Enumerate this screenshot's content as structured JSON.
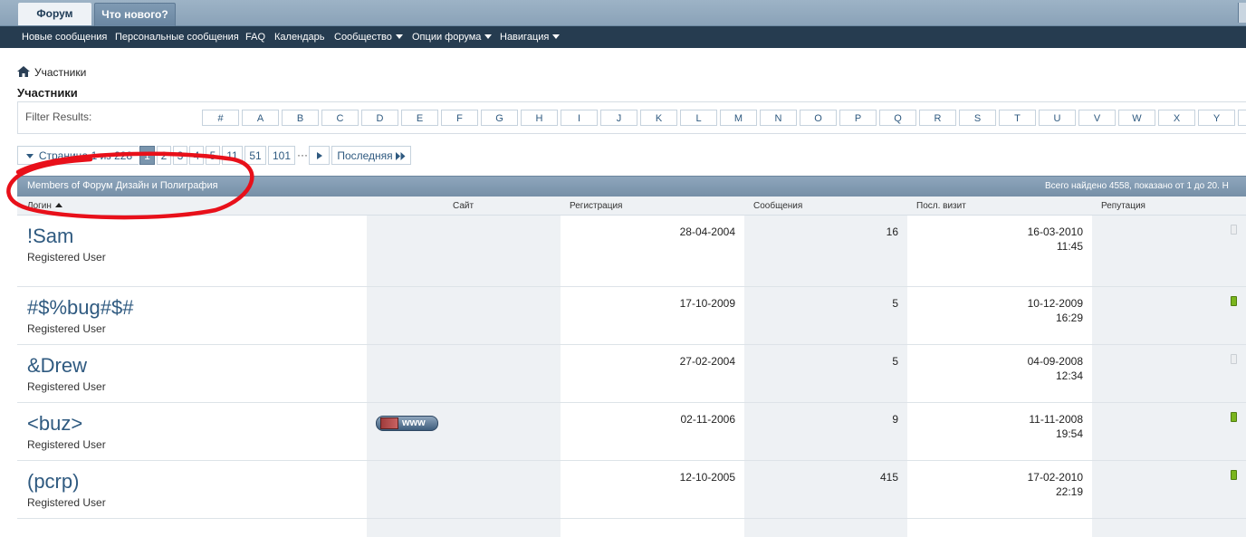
{
  "tabs": [
    {
      "label": "Форум",
      "active": true
    },
    {
      "label": "Что нового?",
      "active": false
    }
  ],
  "navbar": {
    "items": [
      {
        "label": "Новые сообщения",
        "dropdown": false
      },
      {
        "label": "Персональные сообщения",
        "dropdown": false
      },
      {
        "label": "FAQ",
        "dropdown": false
      },
      {
        "label": "Календарь",
        "dropdown": false
      },
      {
        "label": "Сообщество",
        "dropdown": true
      },
      {
        "label": "Опции форума",
        "dropdown": true
      },
      {
        "label": "Навигация",
        "dropdown": true
      }
    ]
  },
  "breadcrumb": {
    "icon": "home-icon",
    "label": "Участники"
  },
  "page_title": "Участники",
  "filter": {
    "label": "Filter Results:",
    "letters": [
      "#",
      "A",
      "B",
      "C",
      "D",
      "E",
      "F",
      "G",
      "H",
      "I",
      "J",
      "K",
      "L",
      "M",
      "N",
      "O",
      "P",
      "Q",
      "R",
      "S",
      "T",
      "U",
      "V",
      "W",
      "X",
      "Y"
    ]
  },
  "pagination": {
    "summary": "Страница 1 из 228",
    "pages": [
      "1",
      "2",
      "3",
      "4",
      "5",
      "11",
      "51",
      "101"
    ],
    "current": "1",
    "ellipsis": "···",
    "last_label": "Последняя"
  },
  "table": {
    "title": "Members of Форум Дизайн и Полиграфия",
    "info": "Всего найдено 4558, показано от 1 до 20. Н",
    "columns": {
      "login": "Логин",
      "site": "Сайт",
      "registration": "Регистрация",
      "posts": "Сообщения",
      "last_visit": "Посл. визит",
      "reputation": "Репутация"
    },
    "rows": [
      {
        "name": "!Sam",
        "title": "Registered User",
        "site": "",
        "registered": "28-04-2004",
        "posts": "16",
        "visit_date": "16-03-2010",
        "visit_time": "11:45",
        "reputation": "neutral"
      },
      {
        "name": "#$%bug#$#",
        "title": "Registered User",
        "site": "",
        "registered": "17-10-2009",
        "posts": "5",
        "visit_date": "10-12-2009",
        "visit_time": "16:29",
        "reputation": "positive"
      },
      {
        "name": "&Drew",
        "title": "Registered User",
        "site": "",
        "registered": "27-02-2004",
        "posts": "5",
        "visit_date": "04-09-2008",
        "visit_time": "12:34",
        "reputation": "neutral"
      },
      {
        "name": "<buz>",
        "title": "Registered User",
        "site": "www",
        "registered": "02-11-2006",
        "posts": "9",
        "visit_date": "11-11-2008",
        "visit_time": "19:54",
        "reputation": "positive"
      },
      {
        "name": "(pcrp)",
        "title": "Registered User",
        "site": "",
        "registered": "12-10-2005",
        "posts": "415",
        "visit_date": "17-02-2010",
        "visit_time": "22:19",
        "reputation": "positive"
      }
    ]
  },
  "colors": {
    "link": "#2f5a80",
    "navbar": "#263c50",
    "annotation": "#e8101a",
    "rep_positive": "#7ab51d"
  }
}
